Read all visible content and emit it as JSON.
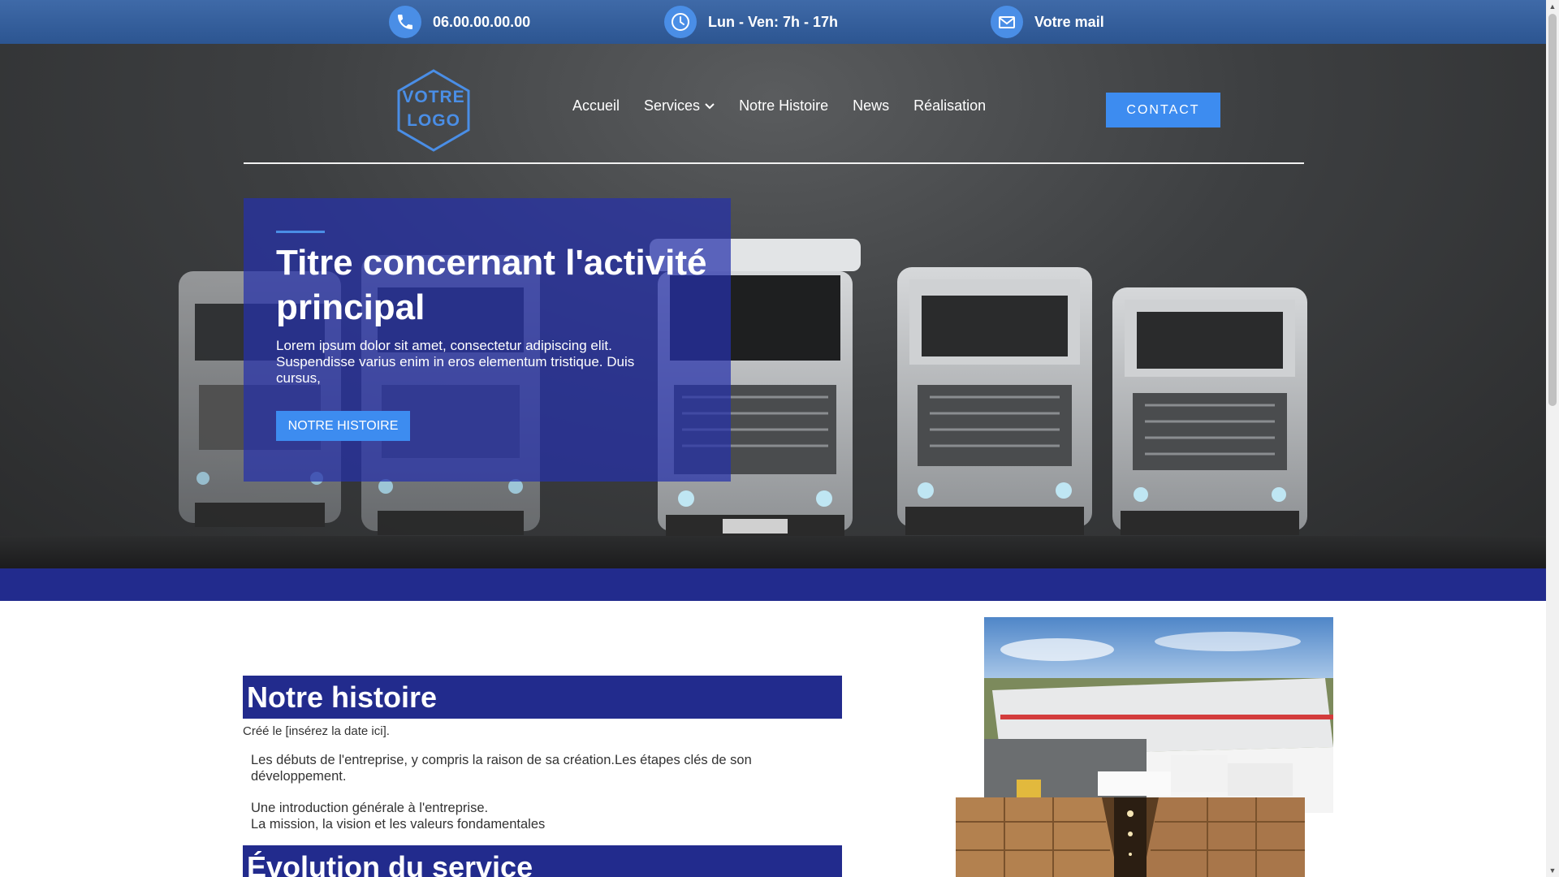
{
  "topbar": {
    "phone": "06.00.00.00.00",
    "hours": "Lun - Ven: 7h - 17h",
    "mail": "Votre mail"
  },
  "logo": {
    "line1": "VOTRE",
    "line2": "LOGO"
  },
  "nav": {
    "items": [
      "Accueil",
      "Services",
      "Notre Histoire",
      "News",
      "Réalisation"
    ],
    "contact_label": "CONTACT"
  },
  "hero": {
    "title": "Titre concernant l'activité principal",
    "text": "Lorem ipsum dolor sit amet, consectetur adipiscing elit. Suspendisse varius enim in eros elementum tristique. Duis cursus,",
    "button_label": "NOTRE HISTOIRE"
  },
  "histoire": {
    "title": "Notre histoire",
    "created": "Créé le [insérez la date ici].",
    "para1": "Les débuts de l'entreprise, y compris la raison de sa création.Les étapes clés de son développement.",
    "para2_line1": "Une introduction générale à l'entreprise.",
    "para2_line2": "La mission, la vision et les valeurs fondamentales"
  },
  "evolution": {
    "title": "Évolution du service"
  },
  "colors": {
    "accent_blue": "#3d8cf0",
    "navy": "#222b8d",
    "topbar": "#2c5591"
  },
  "icons": [
    "phone-icon",
    "clock-icon",
    "mail-icon",
    "chevron-down-icon"
  ]
}
